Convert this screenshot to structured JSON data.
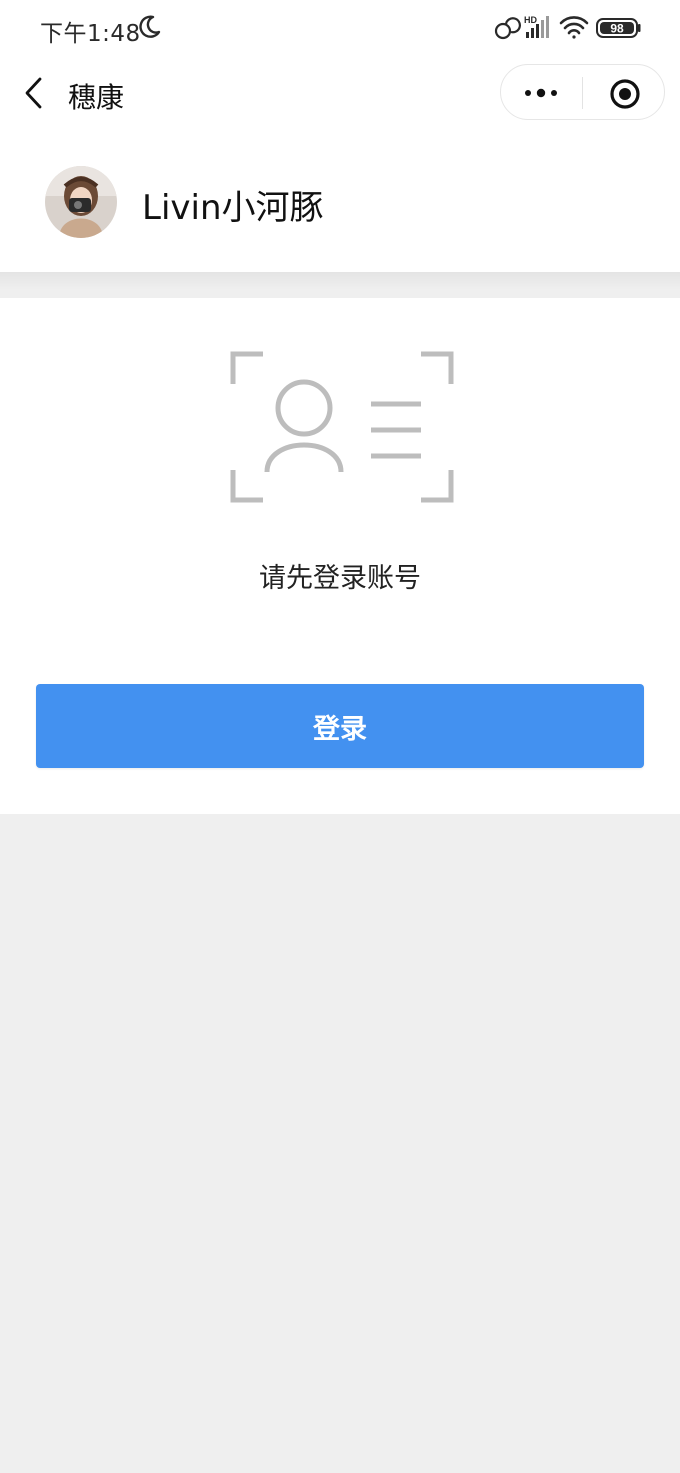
{
  "status_bar": {
    "time": "下午1:48",
    "network_label": "HD",
    "battery": "98"
  },
  "nav": {
    "title": "穗康",
    "back_icon": "chevron-left-icon",
    "more_icon": "more-dots-icon",
    "close_icon": "target-circle-icon"
  },
  "profile": {
    "username": "Livin小河豚"
  },
  "login_card": {
    "illustration_icon": "id-card-scan-icon",
    "prompt": "请先登录账号",
    "login_button_label": "登录"
  },
  "colors": {
    "accent": "#4391f0",
    "page_background": "#efefef",
    "card_background": "#ffffff",
    "illustration_gray": "#bdbdbd"
  }
}
